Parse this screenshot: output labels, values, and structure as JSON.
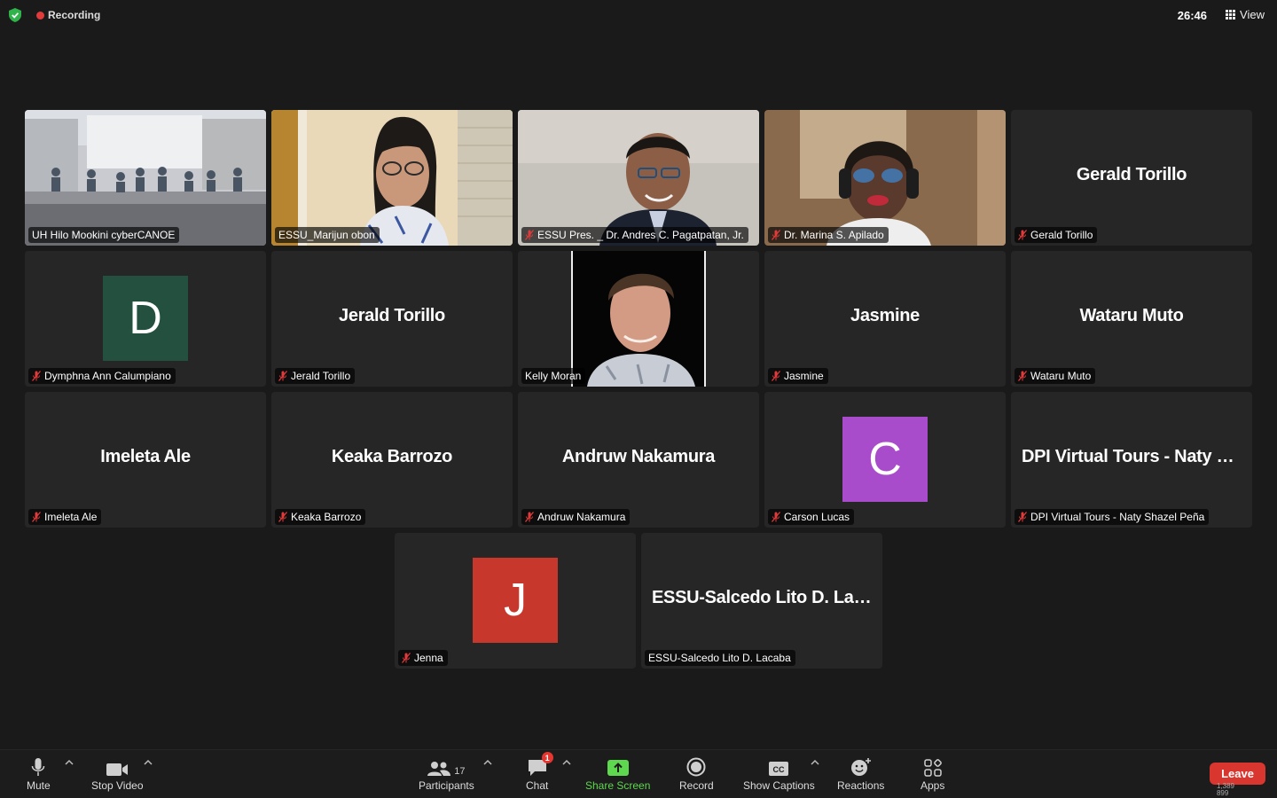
{
  "topbar": {
    "recording_label": "Recording",
    "timer": "26:46",
    "view_label": "View"
  },
  "tiles": [
    {
      "key": "t0",
      "kind": "video",
      "label": "UH Hilo Mookini cyberCANOE",
      "muted": false
    },
    {
      "key": "t1",
      "kind": "video",
      "label": "ESSU_Marijun obon",
      "muted": false,
      "active": true
    },
    {
      "key": "t2",
      "kind": "video",
      "label": "ESSU Pres. _ Dr. Andres C. Pagatpatan, Jr.",
      "muted": true
    },
    {
      "key": "t3",
      "kind": "video",
      "label": "Dr. Marina S. Apilado",
      "muted": true
    },
    {
      "key": "t4",
      "kind": "name",
      "display_name": "Gerald Torillo",
      "label": "Gerald Torillo",
      "muted": true
    },
    {
      "key": "t5",
      "kind": "avatar",
      "initial": "D",
      "avatar_color": "#24513f",
      "label": "Dymphna Ann Calumpiano",
      "muted": true
    },
    {
      "key": "t6",
      "kind": "name",
      "display_name": "Jerald Torillo",
      "label": "Jerald Torillo",
      "muted": true
    },
    {
      "key": "t7",
      "kind": "video",
      "label": "Kelly Moran",
      "muted": false
    },
    {
      "key": "t8",
      "kind": "name",
      "display_name": "Jasmine",
      "label": "Jasmine",
      "muted": true
    },
    {
      "key": "t9",
      "kind": "name",
      "display_name": "Wataru Muto",
      "label": "Wataru Muto",
      "muted": true
    },
    {
      "key": "t10",
      "kind": "name",
      "display_name": "Imeleta Ale",
      "label": "Imeleta Ale",
      "muted": true
    },
    {
      "key": "t11",
      "kind": "name",
      "display_name": "Keaka Barrozo",
      "label": "Keaka Barrozo",
      "muted": true
    },
    {
      "key": "t12",
      "kind": "name",
      "display_name": "Andruw Nakamura",
      "label": "Andruw Nakamura",
      "muted": true
    },
    {
      "key": "t13",
      "kind": "avatar",
      "initial": "C",
      "avatar_color": "#a94ccb",
      "label": "Carson Lucas",
      "muted": true
    },
    {
      "key": "t14",
      "kind": "name",
      "display_name": "DPI Virtual Tours - Naty Shazel Peña",
      "label": "DPI Virtual Tours - Naty Shazel Peña",
      "muted": true
    },
    {
      "key": "t15",
      "kind": "avatar",
      "initial": "J",
      "avatar_color": "#c8372c",
      "label": "Jenna",
      "muted": true
    },
    {
      "key": "t16",
      "kind": "name",
      "display_name": "ESSU-Salcedo Lito D. Lacaba",
      "label": "ESSU-Salcedo Lito D. Lacaba",
      "muted": false
    }
  ],
  "toolbar": {
    "mute_label": "Mute",
    "stop_video_label": "Stop Video",
    "participants_label": "Participants",
    "participants_count": "17",
    "chat_label": "Chat",
    "chat_badge": "1",
    "share_screen_label": "Share Screen",
    "record_label": "Record",
    "captions_label": "Show Captions",
    "reactions_label": "Reactions",
    "apps_label": "Apps",
    "leave_label": "Leave",
    "dims_w": "1,389",
    "dims_h": "899"
  },
  "colors": {
    "accent_green": "#5ed84f",
    "leave_red": "#d9362f",
    "muted_red": "#e03a3a"
  }
}
